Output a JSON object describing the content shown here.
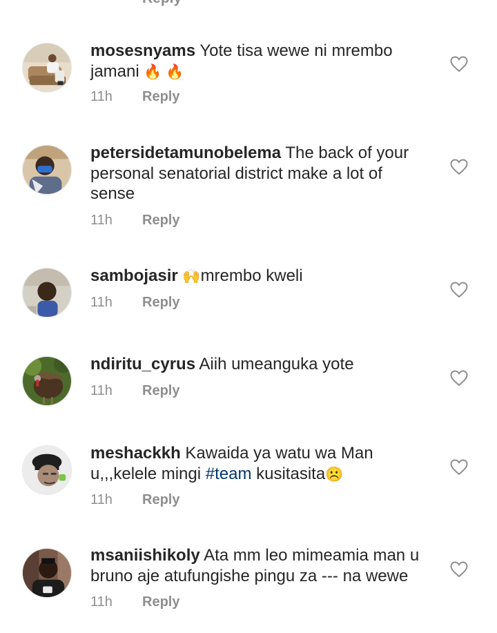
{
  "top_fragment": {
    "reply_label": "Reply"
  },
  "comments": [
    {
      "username": "mosesnyams",
      "text": "Yote tisa wewe ni mrembo jamani",
      "emoji": "🔥 🔥",
      "time": "11h",
      "reply_label": "Reply",
      "avatar_icon": "person-on-couch-avatar"
    },
    {
      "username": "petersidetamunobelema",
      "text": "The back of your personal senatorial district make a lot of sense",
      "time": "11h",
      "reply_label": "Reply",
      "avatar_icon": "masked-man-avatar"
    },
    {
      "username": "sambojasir",
      "emoji": "🙌",
      "text": "mrembo kweli",
      "time": "11h",
      "reply_label": "Reply",
      "avatar_icon": "man-selfie-avatar"
    },
    {
      "username": "ndiritu_cyrus",
      "text": "Aiih umeanguka yote",
      "time": "11h",
      "reply_label": "Reply",
      "avatar_icon": "turkey-avatar"
    },
    {
      "username": "meshackkh",
      "text_a": "Kawaida ya watu wa Man u,,,kelele mingi",
      "hashtag": "#team",
      "text_b": "kusitasita",
      "emoji": "☹️",
      "time": "11h",
      "reply_label": "Reply",
      "avatar_icon": "cartoon-beret-avatar"
    },
    {
      "username": "msaniishikoly",
      "text": "Ata mm leo mimeamia man u bruno aje atufungishe pingu za --- na wewe",
      "time": "11h",
      "reply_label": "Reply",
      "avatar_icon": "man-portrait-avatar"
    }
  ],
  "colors": {
    "text": "#262626",
    "meta": "#8e8e8e",
    "hashtag": "#00376b"
  }
}
